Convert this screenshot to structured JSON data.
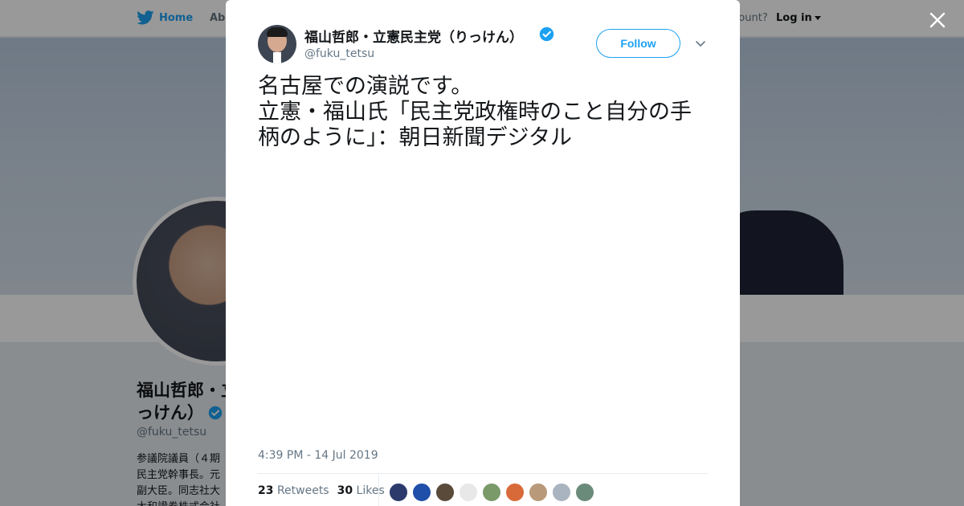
{
  "background": {
    "nav": {
      "home": "Home",
      "about": "Abo",
      "account_prompt": "ccount?",
      "login": "Log in"
    },
    "profile": {
      "name": "福山哲郎・立憲民主党（りっけん）",
      "name_line1": "福山哲郎・立",
      "name_line2": "っけん）",
      "handle": "@fuku_tetsu",
      "bio_lines": [
        "参議院議員（４期",
        "民主党幹事長。元",
        "副大臣。同志社大",
        "大和證券株式会社"
      ]
    }
  },
  "tweet": {
    "author": {
      "name": "福山哲郎・立憲民主党（りっけん）",
      "handle": "@fuku_tetsu",
      "verified": true
    },
    "follow_label": "Follow",
    "text_lines": [
      "名古屋での演説です。",
      "立憲・福山氏「民主党政権時のこと自分の手",
      "柄のように」：朝日新聞デジタル"
    ],
    "timestamp": "4:39 PM - 14 Jul 2019",
    "retweets": {
      "count": "23",
      "label": "Retweets"
    },
    "likes": {
      "count": "30",
      "label": "Likes"
    },
    "liker_colors": [
      "#2b3a6b",
      "#1f4fa8",
      "#5a4a3a",
      "#e8e8e8",
      "#7a9a6a",
      "#d86a3a",
      "#b89a7a",
      "#aab4c0",
      "#6a8a7a"
    ]
  },
  "colors": {
    "brand": "#1da1f2",
    "text": "#14171a",
    "muted": "#657786"
  },
  "icons": [
    "twitter-bird-icon",
    "verified-badge-icon",
    "close-icon",
    "chevron-down-icon"
  ]
}
